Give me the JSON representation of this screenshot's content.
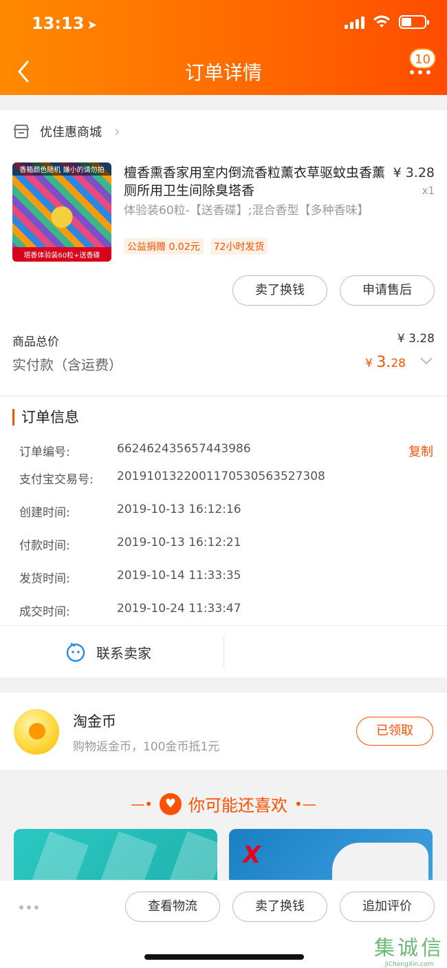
{
  "status_bar": {
    "time": "13:13"
  },
  "nav": {
    "title": "订单详情",
    "badge": "10"
  },
  "shop": {
    "name": "优佳惠商城"
  },
  "product": {
    "image_caption_top": "香箱颜色随机 嫌小的请勿拍",
    "image_caption_bottom": "塔香体验装60粒+送香碟",
    "title": "檀香熏香家用室内倒流香粒薰衣草驱蚊虫香薰厕所用卫生间除臭塔香",
    "price": "¥ 3.28",
    "qty": "x1",
    "sku": "体验装60粒-【送香碟】;混合香型【多种香味】",
    "tags": [
      "公益捐赠 0.02元",
      "72小时发货"
    ]
  },
  "actions": {
    "sell": "卖了换钱",
    "after_sale": "申请售后"
  },
  "summary": {
    "total_label": "商品总价",
    "total_value": "¥ 3.28",
    "paid_label": "实付款（含运费）",
    "paid_currency": "¥ ",
    "paid_int": "3.",
    "paid_dec": "28"
  },
  "order_info": {
    "title": "订单信息",
    "copy": "复制",
    "rows": [
      {
        "label": "订单编号:",
        "value": "662462435657443986"
      },
      {
        "label": "支付宝交易号:",
        "value": "2019101322001170530563527308"
      },
      {
        "label": "创建时间:",
        "value": "2019-10-13 16:12:16"
      },
      {
        "label": "付款时间:",
        "value": "2019-10-13 16:12:21"
      },
      {
        "label": "发货时间:",
        "value": "2019-10-14 11:33:35"
      },
      {
        "label": "成交时间:",
        "value": "2019-10-24 11:33:47"
      }
    ]
  },
  "contact": {
    "label": "联系卖家"
  },
  "coins": {
    "title": "淘金币",
    "subtitle": "购物返金币，100金币抵1元",
    "button": "已领取"
  },
  "recommend": {
    "title": "你可能还喜欢"
  },
  "bottom": {
    "logistics": "查看物流",
    "sell": "卖了换钱",
    "review": "追加评价"
  },
  "watermark": {
    "big": "集诚信",
    "small": "JiChengXin.com"
  },
  "colors": {
    "accent": "#ff5000",
    "header_start": "#ff8a00",
    "header_end": "#ff4c00"
  }
}
